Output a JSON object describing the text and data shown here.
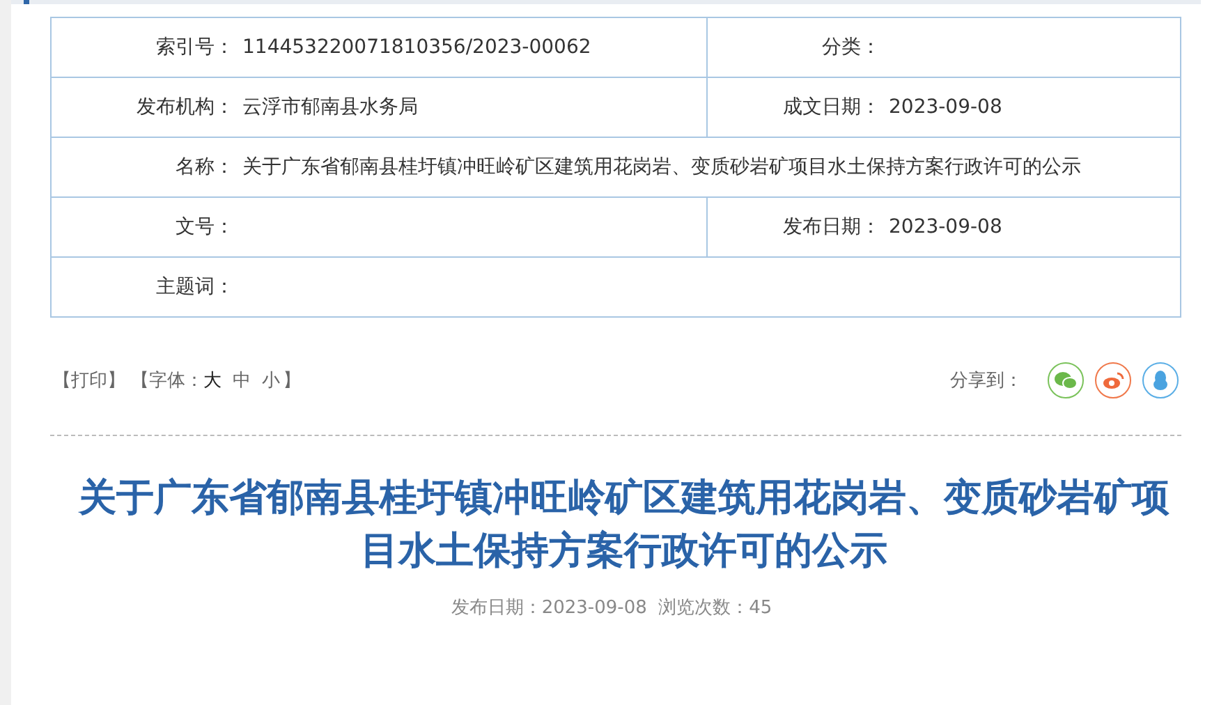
{
  "meta_table": {
    "rows": [
      {
        "cells": [
          {
            "label": "索引号：",
            "value": "114453220071810356/2023-00062"
          },
          {
            "label": "分类："
          }
        ]
      },
      {
        "cells": [
          {
            "label": "发布机构：",
            "value": "云浮市郁南县水务局"
          },
          {
            "label": "成文日期：",
            "value": "2023-09-08"
          }
        ]
      },
      {
        "cells": [
          {
            "label": "名称：",
            "value": "关于广东省郁南县桂圩镇冲旺岭矿区建筑用花岗岩、变质砂岩矿项目水土保持方案行政许可的公示"
          }
        ]
      },
      {
        "cells": [
          {
            "label": "文号："
          },
          {
            "label": "发布日期：",
            "value": "2023-09-08"
          }
        ]
      },
      {
        "cells": [
          {
            "label": "主题词："
          }
        ]
      }
    ]
  },
  "toolbar": {
    "print": "【打印】",
    "font_label": "【字体：",
    "font_sizes": [
      {
        "label": "大",
        "selected": true
      },
      {
        "label": "中",
        "selected": false
      },
      {
        "label": "小",
        "selected": false
      }
    ],
    "font_end": "】",
    "share_label": "分享到："
  },
  "article": {
    "title": "关于广东省郁南县桂圩镇冲旺岭矿区建筑用花岗岩、变质砂岩矿项目水土保持方案行政许可的公示",
    "info": "发布日期：2023-09-08  浏览次数：45"
  }
}
